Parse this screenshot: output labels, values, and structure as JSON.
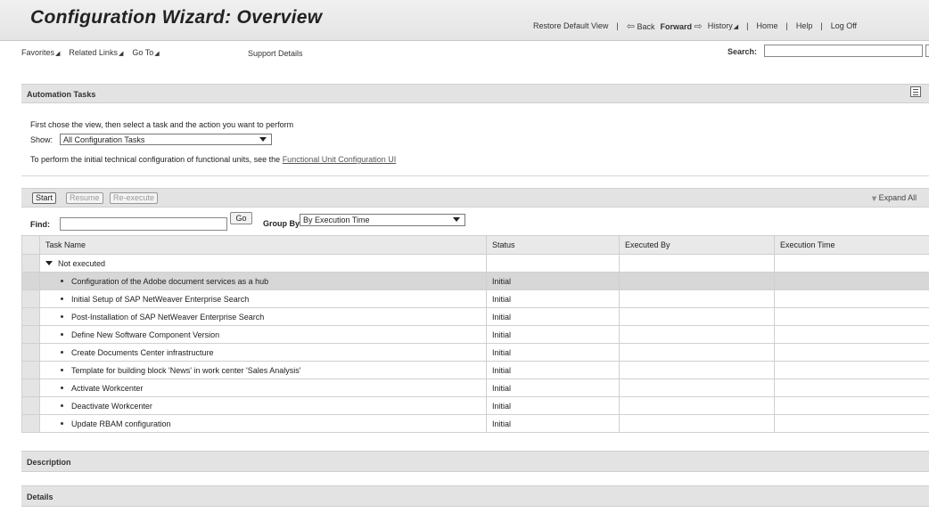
{
  "header": {
    "title": "Configuration Wizard: Overview",
    "restore": "Restore Default View",
    "back": "Back",
    "forward": "Forward",
    "history": "History",
    "home": "Home",
    "help": "Help",
    "logoff": "Log Off"
  },
  "menu": {
    "favorites": "Favorites",
    "related": "Related Links",
    "goto": "Go To",
    "support": "Support Details",
    "search_label": "Search:",
    "search_value": ""
  },
  "automation": {
    "title": "Automation Tasks",
    "intro": "First chose the view, then select a task and the action you want to perform",
    "show_label": "Show:",
    "show_value": "All Configuration Tasks",
    "func_text": "To perform the initial technical configuration of functional units, see the",
    "func_link": "Functional Unit Configuration UI"
  },
  "toolbar": {
    "start": "Start",
    "resume": "Resume",
    "reexecute": "Re-execute",
    "expand": "Expand All"
  },
  "find": {
    "label": "Find:",
    "value": "",
    "go": "Go",
    "group_label": "Group By:",
    "group_value": "By Execution Time"
  },
  "table": {
    "headers": [
      "Task Name",
      "Status",
      "Executed By",
      "Execution Time"
    ],
    "group": "Not executed",
    "rows": [
      {
        "name": "Configuration of the Adobe document services as a hub",
        "status": "Initial"
      },
      {
        "name": "Initial Setup of SAP NetWeaver Enterprise Search",
        "status": "Initial"
      },
      {
        "name": "Post-Installation of SAP NetWeaver Enterprise Search",
        "status": "Initial"
      },
      {
        "name": "Define New Software Component Version",
        "status": "Initial"
      },
      {
        "name": "Create Documents Center infrastructure",
        "status": "Initial"
      },
      {
        "name": "Template for building block 'News' in work center 'Sales Analysis'",
        "status": "Initial"
      },
      {
        "name": "Activate Workcenter",
        "status": "Initial"
      },
      {
        "name": "Deactivate Workcenter",
        "status": "Initial"
      },
      {
        "name": "Update RBAM configuration",
        "status": "Initial"
      }
    ]
  },
  "sections": {
    "description": "Description",
    "details": "Details"
  }
}
